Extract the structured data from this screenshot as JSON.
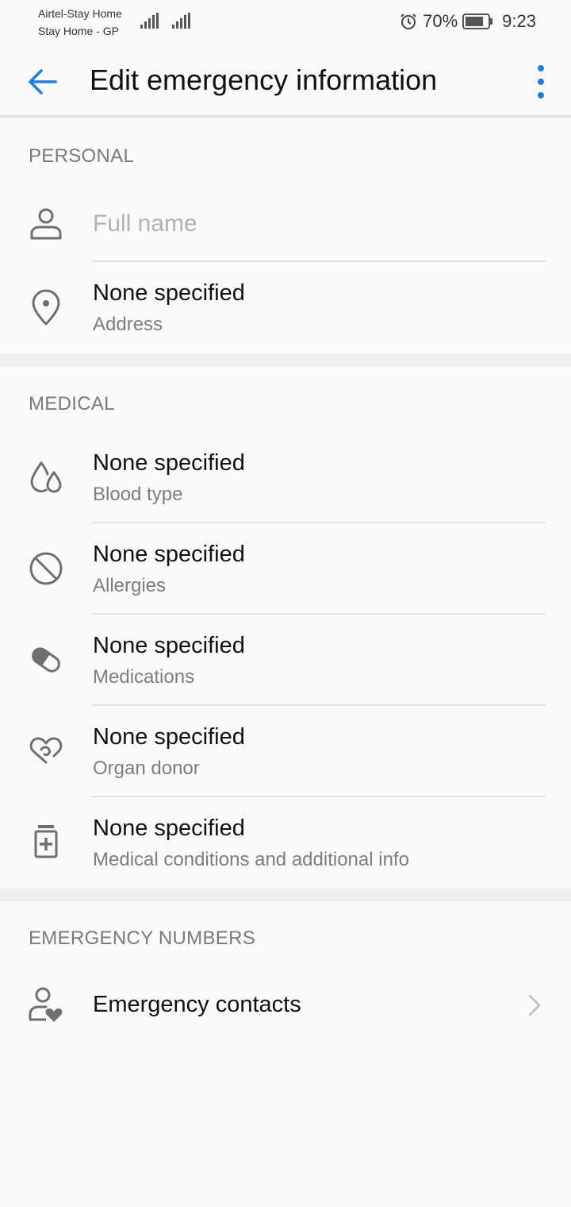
{
  "status_bar": {
    "carrier_line1": "Airtel-Stay Home",
    "carrier_line2": "Stay Home - GP",
    "battery_percent": "70%",
    "time": "9:23",
    "icons": [
      "signal-icon",
      "signal-icon",
      "alarm-icon",
      "battery-icon"
    ]
  },
  "app_bar": {
    "title": "Edit emergency information",
    "back_icon": "arrow-left-icon",
    "more_icon": "more-vertical-icon",
    "accent_color": "#1a7fe0"
  },
  "personal": {
    "header": "PERSONAL",
    "full_name_placeholder": "Full name",
    "address": {
      "value": "None specified",
      "label": "Address",
      "icon": "location-pin-icon"
    }
  },
  "medical": {
    "header": "MEDICAL",
    "items": [
      {
        "value": "None specified",
        "label": "Blood type",
        "icon": "blood-drop-icon"
      },
      {
        "value": "None specified",
        "label": "Allergies",
        "icon": "prohibited-icon"
      },
      {
        "value": "None specified",
        "label": "Medications",
        "icon": "pill-icon"
      },
      {
        "value": "None specified",
        "label": "Organ donor",
        "icon": "heart-hand-icon"
      },
      {
        "value": "None specified",
        "label": "Medical conditions and additional info",
        "icon": "medicine-bottle-icon"
      }
    ]
  },
  "emergency_numbers": {
    "header": "EMERGENCY NUMBERS",
    "contacts_label": "Emergency contacts",
    "icon": "contact-heart-icon"
  }
}
